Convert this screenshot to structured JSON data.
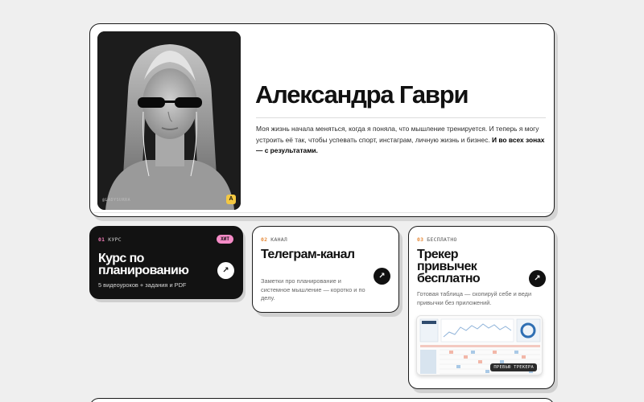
{
  "hero": {
    "name": "Александра Гаври",
    "text_regular": "Моя жизнь начала меняться, когда я поняла, что мышление тренируется. И теперь я могу устроить её так, чтобы успевать спорт, инстаграм, личную жизнь и бизнес. ",
    "text_bold": "И во всех зонах — с результатами.",
    "photo_handle": "@LADYSURRA",
    "photo_badge": "A"
  },
  "cards": [
    {
      "num": "01",
      "tag": "КУРС",
      "badge": "ХИТ",
      "title": "Курс по планированию",
      "desc": "5 видеоуроков + задания и PDF",
      "arrow": "↗"
    },
    {
      "num": "02",
      "tag": "КАНАЛ",
      "title": "Телеграм-канал",
      "desc": "Заметки про планирование и системное мышление — коротко и по делу.",
      "arrow": "↗"
    },
    {
      "num": "03",
      "tag": "БЕСПЛАТНО",
      "title": "Трекер привычек бесплатно",
      "desc": "Готовая таблица — скопируй себе и веди привычки без приложений.",
      "arrow": "↗",
      "preview_caption": "ПРЕВЬЮ ТРЕКЕРА"
    }
  ],
  "colors": {
    "background": "#efefef",
    "card_dark": "#121212",
    "hit_badge": "#f48bc6",
    "accent_orange": "#e58a3a",
    "photo_badge": "#f4c842"
  },
  "icons": {
    "arrow": "arrow-up-right-icon"
  }
}
